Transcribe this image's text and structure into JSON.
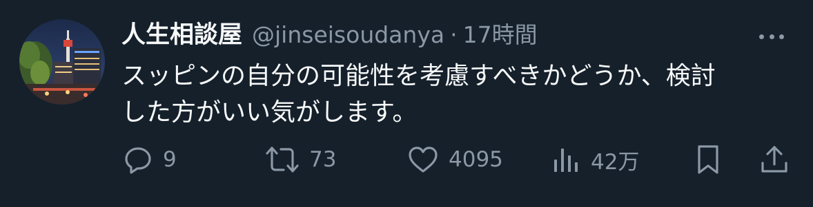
{
  "tweet": {
    "display_name": "人生相談屋",
    "handle": "@jinseisoudanya",
    "separator": "·",
    "time": "17時間",
    "text": "スッピンの自分の可能性を考慮すべきかどうか、検討\nした方がいい気がします。"
  },
  "actions": {
    "reply": {
      "icon": "reply-icon",
      "count": "9"
    },
    "retweet": {
      "icon": "retweet-icon",
      "count": "73"
    },
    "like": {
      "icon": "heart-icon",
      "count": "4095"
    },
    "views": {
      "icon": "views-icon",
      "count": "42万"
    },
    "bookmark": {
      "icon": "bookmark-icon"
    },
    "share": {
      "icon": "share-icon"
    }
  },
  "colors": {
    "background": "#15202b",
    "text": "#f7f9f9",
    "muted": "#8b98a5"
  }
}
